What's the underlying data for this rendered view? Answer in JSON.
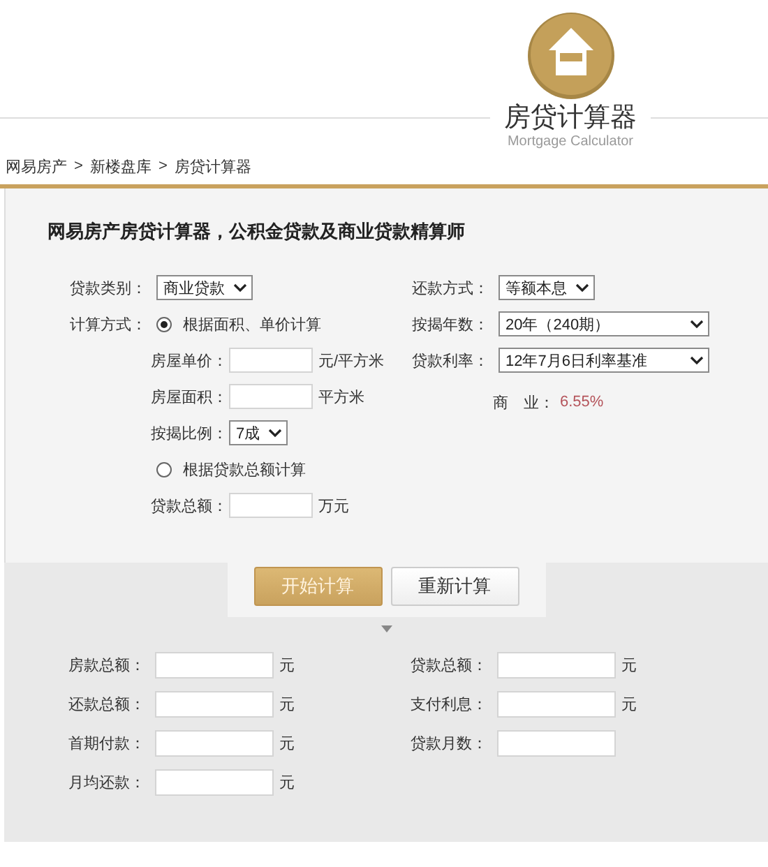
{
  "header": {
    "title": "房贷计算器",
    "subtitle": "Mortgage Calculator"
  },
  "breadcrumb": {
    "separator": ">",
    "items": [
      "网易房产",
      "新楼盘库",
      "房贷计算器"
    ]
  },
  "form": {
    "heading": "网易房产房贷计算器，公积金贷款及商业贷款精算师",
    "left": [
      {
        "kind": "select",
        "label": "贷款类别：",
        "value": "商业贷款"
      },
      {
        "kind": "radio",
        "label": "计算方式：",
        "option": "根据面积、单价计算",
        "selected": true,
        "children": [
          {
            "kind": "input",
            "label": "房屋单价：",
            "unit": "元/平方米"
          },
          {
            "kind": "input",
            "label": "房屋面积：",
            "unit": "平方米"
          },
          {
            "kind": "select",
            "label": "按揭比例：",
            "value": "7成"
          }
        ]
      },
      {
        "kind": "radio",
        "option": "根据贷款总额计算",
        "selected": false,
        "children": [
          {
            "kind": "input",
            "label": "贷款总额：",
            "unit": "万元"
          }
        ]
      }
    ],
    "right": [
      {
        "kind": "select",
        "label": "还款方式：",
        "value": "等额本息"
      },
      {
        "kind": "select",
        "label": "按揭年数：",
        "value": "20年（240期）",
        "wide": true
      },
      {
        "kind": "select",
        "label": "贷款利率：",
        "value": "12年7月6日利率基准",
        "wide": true
      },
      {
        "kind": "rate",
        "label": "商　业：",
        "value": "6.55%"
      }
    ]
  },
  "buttons": [
    {
      "label": "开始计算",
      "primary": true
    },
    {
      "label": "重新计算",
      "primary": false
    }
  ],
  "results": {
    "left": [
      {
        "label": "房款总额：",
        "unit": "元"
      },
      {
        "label": "还款总额：",
        "unit": "元"
      },
      {
        "label": "首期付款：",
        "unit": "元"
      },
      {
        "label": "月均还款：",
        "unit": "元"
      }
    ],
    "right": [
      {
        "label": "贷款总额：",
        "unit": "元"
      },
      {
        "label": "支付利息：",
        "unit": "元"
      },
      {
        "label": "贷款月数："
      }
    ]
  }
}
